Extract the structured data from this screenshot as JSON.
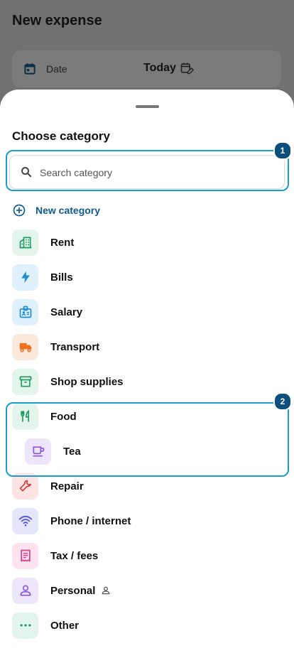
{
  "background": {
    "title": "New expense",
    "date_label": "Date",
    "date_value": "Today"
  },
  "sheet": {
    "title": "Choose category",
    "search_placeholder": "Search category",
    "new_category_label": "New category"
  },
  "categories": [
    {
      "label": "Rent",
      "icon": "building-icon",
      "tile_color": "#e2f4ec",
      "icon_color": "#1f9a63"
    },
    {
      "label": "Bills",
      "icon": "bolt-icon",
      "tile_color": "#e0f1fb",
      "icon_color": "#1e8fd2"
    },
    {
      "label": "Salary",
      "icon": "badge-id-icon",
      "tile_color": "#e0f1fb",
      "icon_color": "#1e8fd2"
    },
    {
      "label": "Transport",
      "icon": "truck-icon",
      "tile_color": "#fde9dc",
      "icon_color": "#f0701e"
    },
    {
      "label": "Shop supplies",
      "icon": "archive-box-icon",
      "tile_color": "#e2f4ec",
      "icon_color": "#1f9a63"
    },
    {
      "label": "Food",
      "icon": "fork-knife-icon",
      "tile_color": "#e2f4ec",
      "icon_color": "#1f9a63"
    },
    {
      "label": "Tea",
      "icon": "cup-icon",
      "tile_color": "#ede6fb",
      "icon_color": "#8a55e0",
      "sub": true
    },
    {
      "label": "Repair",
      "icon": "wrench-icon",
      "tile_color": "#fde3e3",
      "icon_color": "#d23a3a"
    },
    {
      "label": "Phone / internet",
      "icon": "wifi-icon",
      "tile_color": "#e6e6fb",
      "icon_color": "#5b57d9"
    },
    {
      "label": "Tax / fees",
      "icon": "receipt-icon",
      "tile_color": "#fde3ef",
      "icon_color": "#d93d88"
    },
    {
      "label": "Personal",
      "icon": "person-icon",
      "tile_color": "#ede6fb",
      "icon_color": "#8a55e0",
      "personal_marker": true
    },
    {
      "label": "Other",
      "icon": "dots-icon",
      "tile_color": "#e2f4ec",
      "icon_color": "#1f9a63"
    }
  ],
  "annotations": {
    "badge_1": "1",
    "badge_2": "2",
    "highlight_color": "#1b9cd2",
    "badge_color": "#0b4f7f"
  }
}
